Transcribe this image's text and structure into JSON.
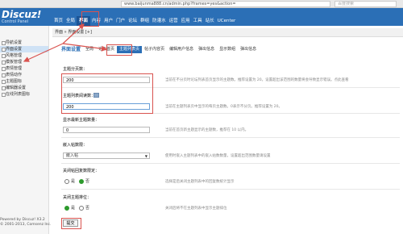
{
  "browser": {
    "url": "www.baijunma888.cn/admin.php?frames=yes&action=",
    "search_placeholder": "百度搜索"
  },
  "logo": {
    "title": "Discuz!",
    "subtitle": "Control Panel"
  },
  "topnav": {
    "items": [
      "首页",
      "全局",
      "界面",
      "内容",
      "用户",
      "门户",
      "论坛",
      "群组",
      "防灌水",
      "运营",
      "应用",
      "工具",
      "站长",
      "UCenter"
    ],
    "active": "界面"
  },
  "breadcrumb": "界面 » 界面设置 [+]",
  "sidebar": {
    "items": [
      "导航设置",
      "界面设置",
      "风格管理",
      "模板管理",
      "表情管理",
      "表情动作",
      "主题图标",
      "编辑器设置",
      "在线列表图标"
    ],
    "active": "界面设置",
    "footer1": "Powered by Discuz! X3.2",
    "footer2": "© 2001-2013, Comsenz Inc."
  },
  "tabs": {
    "items": [
      "界面设置",
      "全局",
      "论坛首页",
      "主题列表页",
      "帖子内容页",
      "编辑用户信息",
      "弹出信息",
      "显示数组",
      "弹出信息"
    ],
    "active": "主题列表页"
  },
  "form": {
    "field1": {
      "label": "主题分页数：",
      "value": "200",
      "hint": "当前在不分页时论坛列表首页显示的主题数。推荐设置为 20。设置超出该范围的数量将会导致显示错误。点此查看"
    },
    "field2": {
      "label": "主题列表阅读数：",
      "value": "200",
      "hint": "当前在主题列表页中显示的每页主题数。0表示不分页。推荐设置为 20。"
    },
    "field3": {
      "label": "显示最新主题数量：",
      "value": "0",
      "hint": "当前在首页新主题显示的主题数，推荐在 10 以内。"
    },
    "field4": {
      "label": "嵌入帖数限：",
      "select": "嵌入帖",
      "hint": "使用时嵌入主题列表中的嵌入帖数数量，设置超出范围数量请设置"
    },
    "radio1": {
      "label": "关闭帖回复数限定：",
      "yes": "是",
      "no": "否",
      "hint": "选择是后关闭主题列表中的回复数统计显示"
    },
    "radio2": {
      "label": "关闭主题排位：",
      "yes": "是",
      "no": "否",
      "hint": "关闭后将不在主题列表中显示主题排位"
    },
    "submit": "提交",
    "link": "点此查看"
  }
}
